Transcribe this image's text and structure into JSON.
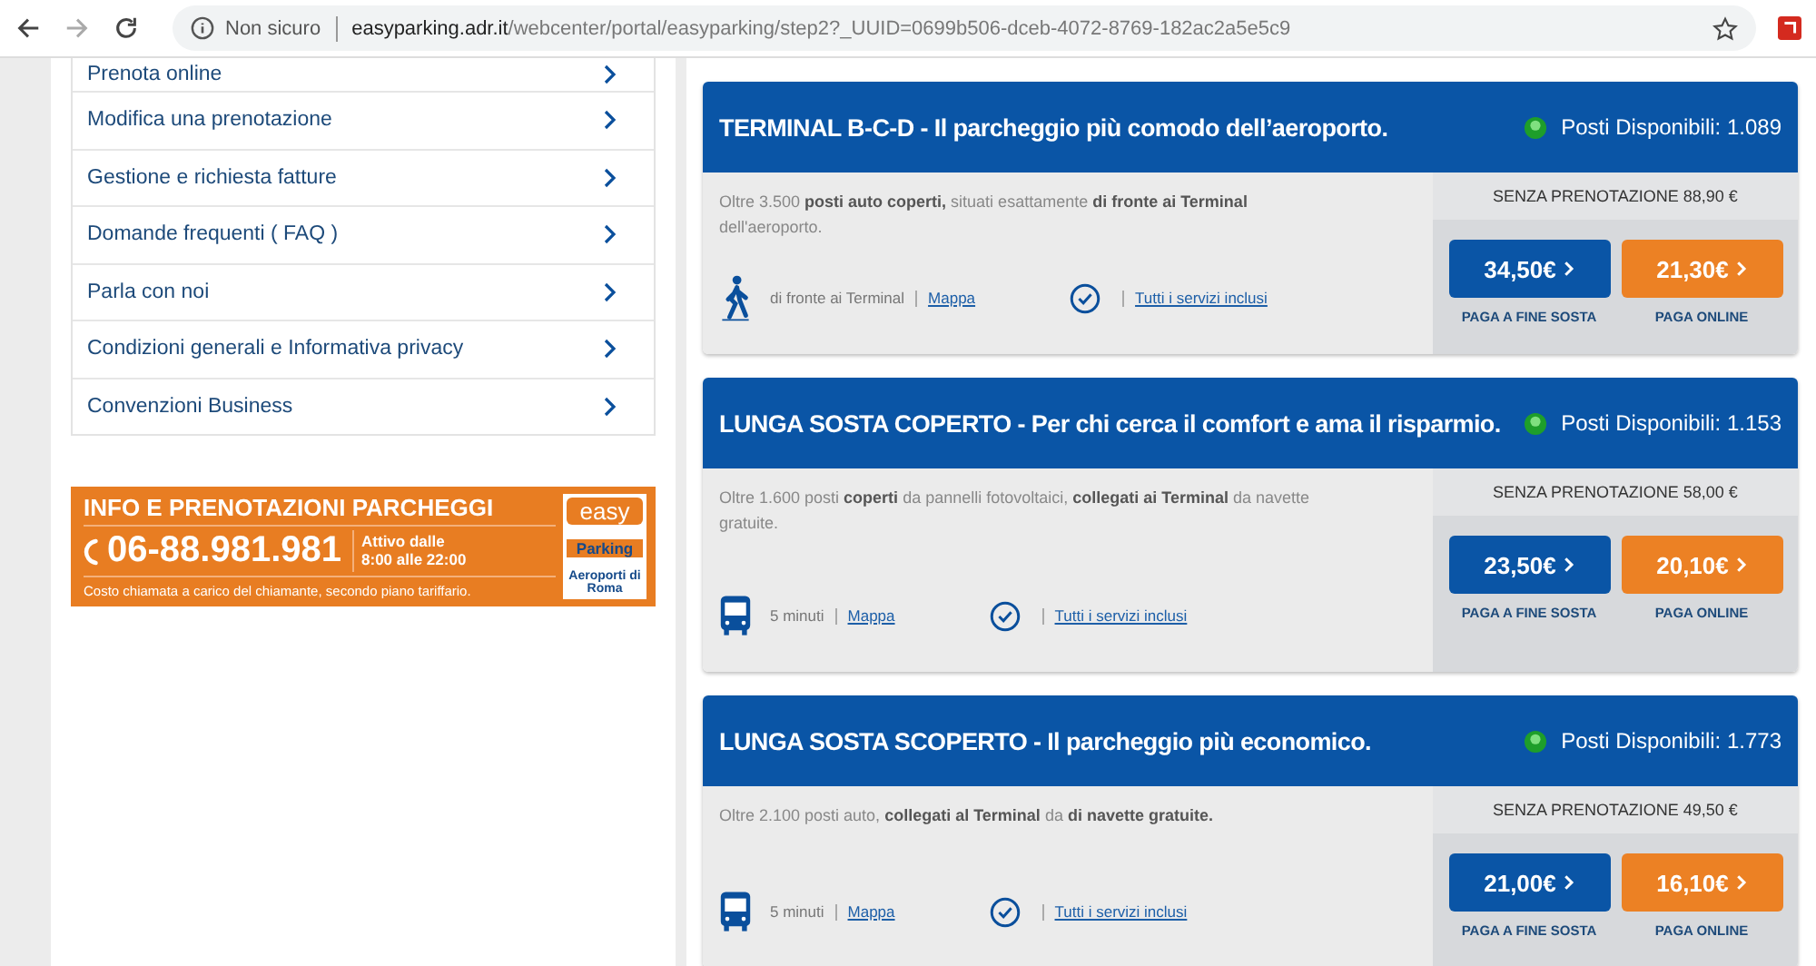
{
  "browser": {
    "security": "Non sicuro",
    "url_host": "easyparking.adr.it",
    "url_path": "/webcenter/portal/easyparking/step2?_UUID=0699b506-dceb-4072-8769-182ac2a5e5c9"
  },
  "menu": [
    "Prenota online",
    "Modifica una prenotazione",
    "Gestione e richiesta fatture",
    "Domande frequenti ( FAQ )",
    "Parla con noi",
    "Condizioni generali e Informativa privacy",
    "Convenzioni Business"
  ],
  "banner": {
    "title": "INFO E PRENOTAZIONI PARCHEGGI",
    "phone": "06-88.981.981",
    "hours": [
      "Attivo dalle",
      "8:00 alle 22:00"
    ],
    "note": "Costo chiamata a carico del chiamante, secondo piano tariffario.",
    "logo": {
      "top": "easy",
      "middle": "Parking",
      "bottom": "Aeroporti di Roma"
    }
  },
  "cards": [
    {
      "title": "TERMINAL B-C-D - Il parcheggio più comodo dell’aeroporto.",
      "availability": "Posti Disponibili: 1.089",
      "description": "Oltre 3.500 **posti auto coperti,** situati esattamente **di fronte ai Terminal** dell'aeroporto.",
      "kind": "walk",
      "access": "di fronte ai Terminal",
      "map_link": "Mappa",
      "services_link": "Tutti i servizi inclusi",
      "no_reservation": "SENZA PRENOTAZIONE 88,90 €",
      "prices": [
        {
          "kind": "pay-later",
          "price": "34,50€",
          "label": "PAGA A FINE SOSTA"
        },
        {
          "kind": "pay-online",
          "price": "21,30€",
          "label": "PAGA ONLINE"
        }
      ]
    },
    {
      "title": "LUNGA SOSTA COPERTO - Per chi cerca il comfort e ama il risparmio.",
      "availability": "Posti Disponibili: 1.153",
      "description": "Oltre 1.600 posti **coperti** da pannelli fotovoltaici, **collegati ai Terminal** da navette gratuite.",
      "kind": "bus",
      "access": "5 minuti",
      "map_link": "Mappa",
      "services_link": "Tutti i servizi inclusi",
      "no_reservation": "SENZA PRENOTAZIONE 58,00 €",
      "prices": [
        {
          "kind": "pay-later",
          "price": "23,50€",
          "label": "PAGA A FINE SOSTA"
        },
        {
          "kind": "pay-online",
          "price": "20,10€",
          "label": "PAGA ONLINE"
        }
      ]
    },
    {
      "title": "LUNGA SOSTA SCOPERTO - Il parcheggio più economico.",
      "availability": "Posti Disponibili: 1.773",
      "description": "Oltre 2.100 posti auto, **collegati al Terminal** da **di navette gratuite.**",
      "kind": "bus",
      "access": "5 minuti",
      "map_link": "Mappa",
      "services_link": "Tutti i servizi inclusi",
      "no_reservation": "SENZA PRENOTAZIONE 49,50 €",
      "prices": [
        {
          "kind": "pay-later",
          "price": "21,00€",
          "label": "PAGA A FINE SOSTA"
        },
        {
          "kind": "pay-online",
          "price": "16,10€",
          "label": "PAGA ONLINE"
        }
      ]
    }
  ]
}
